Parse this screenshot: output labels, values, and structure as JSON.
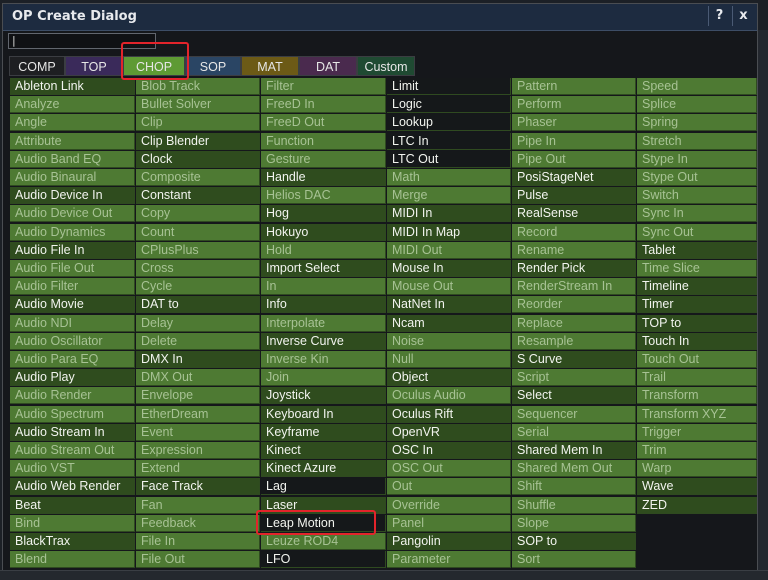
{
  "window": {
    "title": "OP Create Dialog",
    "help_label": "?",
    "close_label": "x"
  },
  "search": {
    "value": "|"
  },
  "tabs": [
    {
      "label": "COMP",
      "bg": "#1e1f22",
      "color": "#e6e6e6"
    },
    {
      "label": "TOP",
      "bg": "#3a2a5a",
      "color": "#e6e6e6"
    },
    {
      "label": "CHOP",
      "bg": "#5e9a34",
      "color": "#e6e6e6",
      "active": true
    },
    {
      "label": "SOP",
      "bg": "#2a4564",
      "color": "#e6e6e6"
    },
    {
      "label": "MAT",
      "bg": "#6c5a16",
      "color": "#e6e6e6"
    },
    {
      "label": "DAT",
      "bg": "#4a2a4e",
      "color": "#e6e6e6"
    },
    {
      "label": "Custom",
      "bg": "#1f4a32",
      "color": "#e6e6e6"
    }
  ],
  "colors": {
    "licensed_bg": "#2f4c1e",
    "licensed_text": "#f2f4ef",
    "unlicensed_bg": "#4e7a33",
    "unlicensed_text": "#a7c294",
    "highlight": "#e3242b"
  },
  "columns": [
    [
      {
        "label": "Ableton Link",
        "on": true
      },
      {
        "label": "Analyze"
      },
      {
        "label": "Angle"
      },
      {
        "label": "Attribute"
      },
      {
        "label": "Audio Band EQ"
      },
      {
        "label": "Audio Binaural"
      },
      {
        "label": "Audio Device In",
        "on": true
      },
      {
        "label": "Audio Device Out"
      },
      {
        "label": "Audio Dynamics"
      },
      {
        "label": "Audio File In",
        "on": true
      },
      {
        "label": "Audio File Out"
      },
      {
        "label": "Audio Filter"
      },
      {
        "label": "Audio Movie",
        "on": true
      },
      {
        "label": "Audio NDI"
      },
      {
        "label": "Audio Oscillator"
      },
      {
        "label": "Audio Para EQ"
      },
      {
        "label": "Audio Play",
        "on": true
      },
      {
        "label": "Audio Render"
      },
      {
        "label": "Audio Spectrum"
      },
      {
        "label": "Audio Stream In",
        "on": true
      },
      {
        "label": "Audio Stream Out"
      },
      {
        "label": "Audio VST"
      },
      {
        "label": "Audio Web Render",
        "on": true
      },
      {
        "label": "Beat",
        "on": true
      },
      {
        "label": "Bind"
      },
      {
        "label": "BlackTrax",
        "on": true
      },
      {
        "label": "Blend"
      }
    ],
    [
      {
        "label": "Blob Track"
      },
      {
        "label": "Bullet Solver"
      },
      {
        "label": "Clip"
      },
      {
        "label": "Clip Blender",
        "on": true
      },
      {
        "label": "Clock",
        "on": true
      },
      {
        "label": "Composite"
      },
      {
        "label": "Constant",
        "on": true
      },
      {
        "label": "Copy"
      },
      {
        "label": "Count"
      },
      {
        "label": "CPlusPlus"
      },
      {
        "label": "Cross"
      },
      {
        "label": "Cycle"
      },
      {
        "label": "DAT to",
        "on": true
      },
      {
        "label": "Delay"
      },
      {
        "label": "Delete"
      },
      {
        "label": "DMX In",
        "on": true
      },
      {
        "label": "DMX Out"
      },
      {
        "label": "Envelope"
      },
      {
        "label": "EtherDream"
      },
      {
        "label": "Event"
      },
      {
        "label": "Expression"
      },
      {
        "label": "Extend"
      },
      {
        "label": "Face Track",
        "on": true
      },
      {
        "label": "Fan"
      },
      {
        "label": "Feedback"
      },
      {
        "label": "File In"
      },
      {
        "label": "File Out"
      }
    ],
    [
      {
        "label": "Filter"
      },
      {
        "label": "FreeD In"
      },
      {
        "label": "FreeD Out"
      },
      {
        "label": "Function"
      },
      {
        "label": "Gesture"
      },
      {
        "label": "Handle",
        "on": true
      },
      {
        "label": "Helios DAC"
      },
      {
        "label": "Hog",
        "on": true
      },
      {
        "label": "Hokuyo",
        "on": true
      },
      {
        "label": "Hold"
      },
      {
        "label": "Import Select",
        "on": true
      },
      {
        "label": "In"
      },
      {
        "label": "Info",
        "on": true
      },
      {
        "label": "Interpolate"
      },
      {
        "label": "Inverse Curve",
        "on": true
      },
      {
        "label": "Inverse Kin"
      },
      {
        "label": "Join"
      },
      {
        "label": "Joystick",
        "on": true
      },
      {
        "label": "Keyboard In",
        "on": true
      },
      {
        "label": "Keyframe",
        "on": true
      },
      {
        "label": "Kinect",
        "on": true
      },
      {
        "label": "Kinect Azure",
        "on": true
      },
      {
        "label": "Lag",
        "on": true,
        "dark": true
      },
      {
        "label": "Laser",
        "on": true
      },
      {
        "label": "Leap Motion",
        "on": true,
        "dark": true
      },
      {
        "label": "Leuze ROD4"
      },
      {
        "label": "LFO",
        "on": true,
        "dark": true
      }
    ],
    [
      {
        "label": "Limit",
        "on": true,
        "dark": true
      },
      {
        "label": "Logic",
        "on": true,
        "dark": true
      },
      {
        "label": "Lookup",
        "on": true,
        "dark": true
      },
      {
        "label": "LTC In",
        "on": true,
        "dark": true
      },
      {
        "label": "LTC Out",
        "on": true,
        "dark": true
      },
      {
        "label": "Math"
      },
      {
        "label": "Merge"
      },
      {
        "label": "MIDI In",
        "on": true
      },
      {
        "label": "MIDI In Map",
        "on": true
      },
      {
        "label": "MIDI Out"
      },
      {
        "label": "Mouse In",
        "on": true
      },
      {
        "label": "Mouse Out"
      },
      {
        "label": "NatNet In",
        "on": true
      },
      {
        "label": "Ncam",
        "on": true
      },
      {
        "label": "Noise"
      },
      {
        "label": "Null"
      },
      {
        "label": "Object",
        "on": true
      },
      {
        "label": "Oculus Audio"
      },
      {
        "label": "Oculus Rift",
        "on": true
      },
      {
        "label": "OpenVR",
        "on": true
      },
      {
        "label": "OSC In",
        "on": true
      },
      {
        "label": "OSC Out"
      },
      {
        "label": "Out"
      },
      {
        "label": "Override"
      },
      {
        "label": "Panel"
      },
      {
        "label": "Pangolin",
        "on": true
      },
      {
        "label": "Parameter"
      }
    ],
    [
      {
        "label": "Pattern"
      },
      {
        "label": "Perform"
      },
      {
        "label": "Phaser"
      },
      {
        "label": "Pipe In"
      },
      {
        "label": "Pipe Out"
      },
      {
        "label": "PosiStageNet",
        "on": true
      },
      {
        "label": "Pulse",
        "on": true
      },
      {
        "label": "RealSense",
        "on": true
      },
      {
        "label": "Record"
      },
      {
        "label": "Rename"
      },
      {
        "label": "Render Pick",
        "on": true
      },
      {
        "label": "RenderStream In"
      },
      {
        "label": "Reorder"
      },
      {
        "label": "Replace"
      },
      {
        "label": "Resample"
      },
      {
        "label": "S Curve",
        "on": true
      },
      {
        "label": "Script"
      },
      {
        "label": "Select",
        "on": true
      },
      {
        "label": "Sequencer"
      },
      {
        "label": "Serial"
      },
      {
        "label": "Shared Mem In",
        "on": true
      },
      {
        "label": "Shared Mem Out"
      },
      {
        "label": "Shift"
      },
      {
        "label": "Shuffle"
      },
      {
        "label": "Slope"
      },
      {
        "label": "SOP to",
        "on": true
      },
      {
        "label": "Sort"
      }
    ],
    [
      {
        "label": "Speed"
      },
      {
        "label": "Splice"
      },
      {
        "label": "Spring"
      },
      {
        "label": "Stretch"
      },
      {
        "label": "Stype In"
      },
      {
        "label": "Stype Out"
      },
      {
        "label": "Switch"
      },
      {
        "label": "Sync In"
      },
      {
        "label": "Sync Out"
      },
      {
        "label": "Tablet",
        "on": true
      },
      {
        "label": "Time Slice"
      },
      {
        "label": "Timeline",
        "on": true
      },
      {
        "label": "Timer",
        "on": true
      },
      {
        "label": "TOP to",
        "on": true
      },
      {
        "label": "Touch In",
        "on": true
      },
      {
        "label": "Touch Out"
      },
      {
        "label": "Trail"
      },
      {
        "label": "Transform"
      },
      {
        "label": "Transform XYZ"
      },
      {
        "label": "Trigger"
      },
      {
        "label": "Trim"
      },
      {
        "label": "Warp"
      },
      {
        "label": "Wave",
        "on": true
      },
      {
        "label": "ZED",
        "on": true
      }
    ]
  ]
}
